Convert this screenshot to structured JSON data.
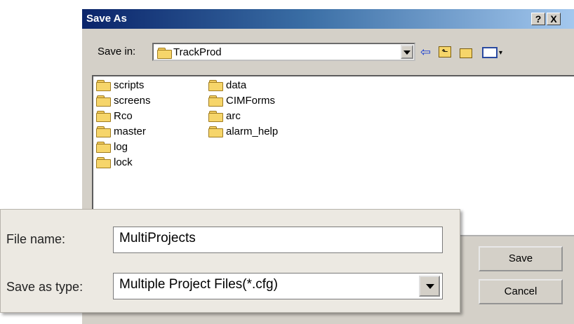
{
  "window": {
    "title": "Save As",
    "help": "?",
    "close": "X"
  },
  "save_in": {
    "label": "Save in:",
    "value": "TrackProd"
  },
  "toolbar_icons": [
    "back-arrow-icon",
    "up-folder-icon",
    "new-folder-icon",
    "view-menu-icon"
  ],
  "folders": {
    "col1": [
      "scripts",
      "screens",
      "Rco",
      "master",
      "log",
      "lock"
    ],
    "col2": [
      "data",
      "CIMForms",
      "arc",
      "alarm_help"
    ]
  },
  "file_name": {
    "label": "File name:",
    "value": "MultiProjects"
  },
  "save_as_type": {
    "label": "Save as type:",
    "value": "Multiple Project Files(*.cfg)"
  },
  "buttons": {
    "save": "Save",
    "cancel": "Cancel"
  }
}
